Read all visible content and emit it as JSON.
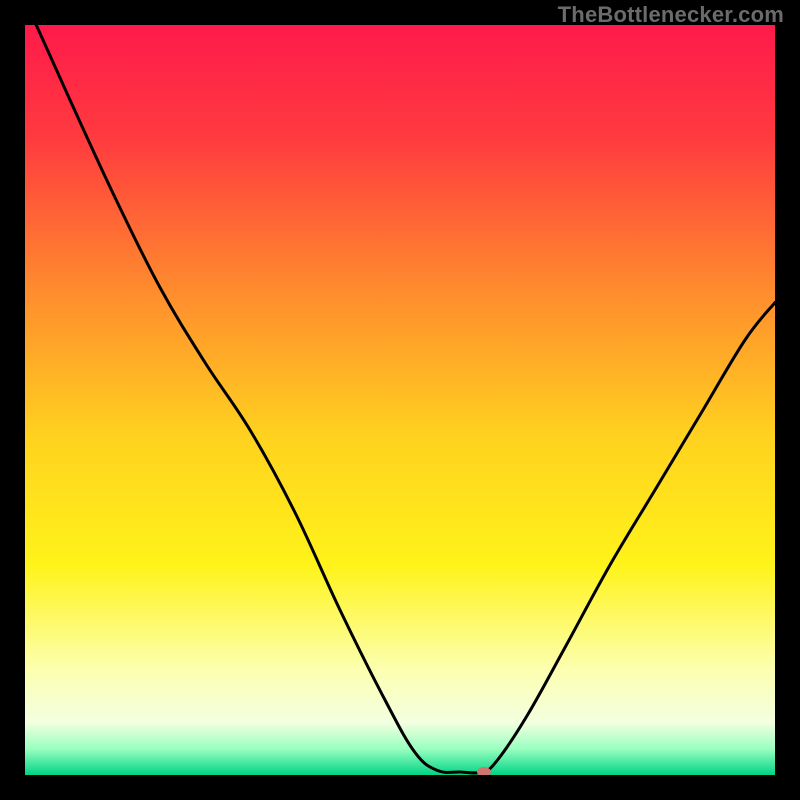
{
  "watermark": "TheBottlenecker.com",
  "chart_data": {
    "type": "line",
    "title": "",
    "xlabel": "",
    "ylabel": "",
    "xlim": [
      0,
      100
    ],
    "ylim": [
      0,
      100
    ],
    "gradient_stops": [
      {
        "offset": 0.0,
        "color": "#ff1a4b"
      },
      {
        "offset": 0.15,
        "color": "#ff3a3f"
      },
      {
        "offset": 0.35,
        "color": "#ff8a2e"
      },
      {
        "offset": 0.55,
        "color": "#ffd21f"
      },
      {
        "offset": 0.72,
        "color": "#fff31a"
      },
      {
        "offset": 0.86,
        "color": "#fcffb0"
      },
      {
        "offset": 0.93,
        "color": "#f3ffe0"
      },
      {
        "offset": 0.965,
        "color": "#9affc0"
      },
      {
        "offset": 1.0,
        "color": "#00d486"
      }
    ],
    "series": [
      {
        "name": "bottleneck-curve",
        "color": "#000000",
        "width": 3,
        "points": [
          {
            "x": 1.5,
            "y": 100.0
          },
          {
            "x": 6.0,
            "y": 90.0
          },
          {
            "x": 12.0,
            "y": 77.0
          },
          {
            "x": 18.0,
            "y": 65.0
          },
          {
            "x": 24.0,
            "y": 55.0
          },
          {
            "x": 30.0,
            "y": 46.0
          },
          {
            "x": 36.0,
            "y": 35.0
          },
          {
            "x": 42.0,
            "y": 22.0
          },
          {
            "x": 48.0,
            "y": 10.0
          },
          {
            "x": 52.0,
            "y": 3.0
          },
          {
            "x": 55.0,
            "y": 0.6
          },
          {
            "x": 58.0,
            "y": 0.4
          },
          {
            "x": 61.0,
            "y": 0.4
          },
          {
            "x": 63.0,
            "y": 2.0
          },
          {
            "x": 67.0,
            "y": 8.0
          },
          {
            "x": 72.0,
            "y": 17.0
          },
          {
            "x": 78.0,
            "y": 28.0
          },
          {
            "x": 84.0,
            "y": 38.0
          },
          {
            "x": 90.0,
            "y": 48.0
          },
          {
            "x": 96.0,
            "y": 58.0
          },
          {
            "x": 100.0,
            "y": 63.0
          }
        ]
      }
    ],
    "marker": {
      "x": 61.2,
      "y": 0.4,
      "rx": 7,
      "ry": 5,
      "color": "#cf776f"
    }
  }
}
